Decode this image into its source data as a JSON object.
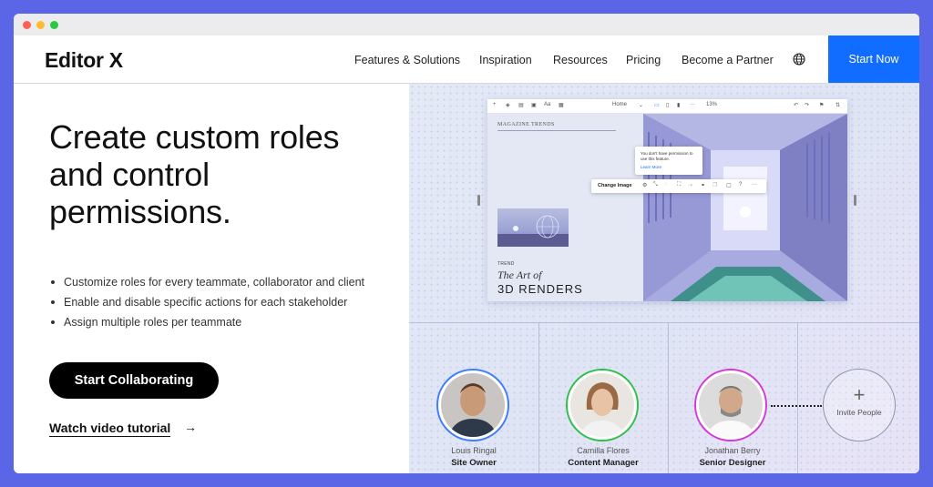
{
  "header": {
    "logo": "Editor X",
    "nav": [
      "Features & Solutions",
      "Inspiration",
      "Resources",
      "Pricing",
      "Become a Partner"
    ],
    "globe_icon": "globe-icon",
    "start_now": "Start Now",
    "accent": "#116dff"
  },
  "hero": {
    "headline": "Create custom roles and control permissions.",
    "bullets": [
      "Customize roles for every teammate, collaborator and client",
      "Enable and disable specific actions for each stakeholder",
      "Assign multiple roles per teammate"
    ],
    "cta": "Start Collaborating",
    "video_link": "Watch video tutorial",
    "video_arrow": "→"
  },
  "editor_mock": {
    "page_select": "Home",
    "zoom": "13%",
    "magazine_label": "MAGAZINE TRENDS",
    "trend_label": "TREND",
    "art_title": "The Art of",
    "renders_title": "3D RENDERS",
    "permission_text": "You don't have permission to use this feature.",
    "learn_more": "Learn More",
    "change_image": "Change Image"
  },
  "team": [
    {
      "name": "Louis Ringal",
      "role": "Site Owner",
      "ring_color": "#3f7bff"
    },
    {
      "name": "Camilla Flores",
      "role": "Content Manager",
      "ring_color": "#2fbf4a"
    },
    {
      "name": "Jonathan Berry",
      "role": "Senior Designer",
      "ring_color": "#d43ad8"
    }
  ],
  "invite": {
    "plus": "+",
    "label": "Invite People"
  }
}
